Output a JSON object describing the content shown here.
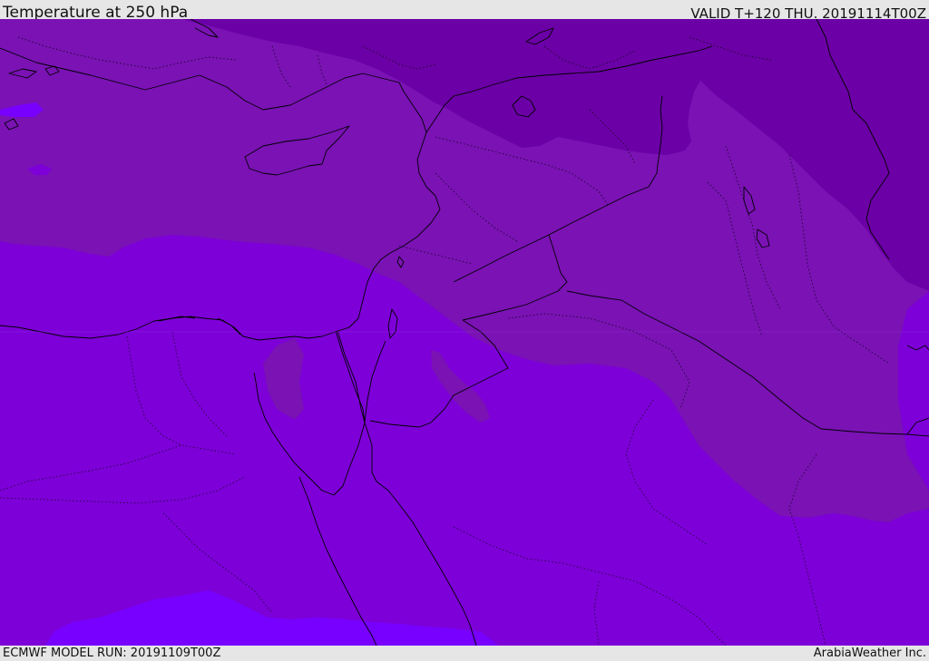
{
  "header": {
    "title": "Temperature at 250 hPa",
    "valid_time": "VALID T+120 THU. 20191114T00Z"
  },
  "footer": {
    "model_run": "ECMWF MODEL RUN: 20191109T00Z",
    "credit": "ArabiaWeather Inc."
  },
  "map": {
    "colors": {
      "coldest_band": "#6b00a6",
      "cold_band": "#7a12b4",
      "mid_band": "#7d00d8",
      "warm_band": "#7700ff",
      "boundary_line": "#000000"
    }
  }
}
